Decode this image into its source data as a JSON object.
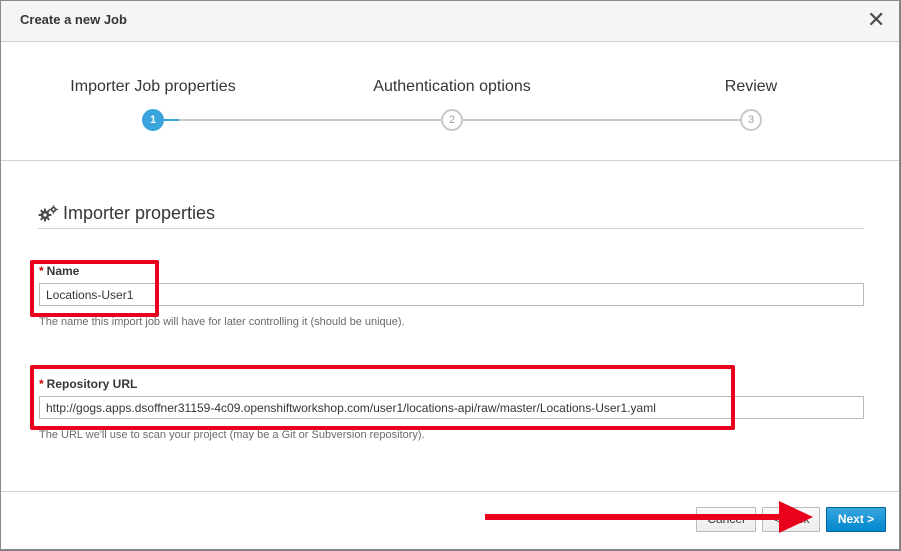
{
  "dialog": {
    "title": "Create a new Job",
    "close_symbol": "✕"
  },
  "wizard": {
    "steps": [
      {
        "label": "Importer Job properties",
        "number": "1",
        "state": "active"
      },
      {
        "label": "Authentication options",
        "number": "2",
        "state": "inactive"
      },
      {
        "label": "Review",
        "number": "3",
        "state": "inactive"
      }
    ]
  },
  "section": {
    "title": "Importer properties",
    "icon": "gears-icon"
  },
  "form": {
    "name": {
      "required_marker": "*",
      "label": "Name",
      "value": "Locations-User1",
      "help": "The name this import job will have for later controlling it (should be unique)."
    },
    "repository_url": {
      "required_marker": "*",
      "label": "Repository URL",
      "value": "http://gogs.apps.dsoffner31159-4c09.openshiftworkshop.com/user1/locations-api/raw/master/Locations-User1.yaml",
      "help": "The URL we'll use to scan your project (may be a Git or Subversion repository)."
    }
  },
  "footer": {
    "cancel_label": "Cancel",
    "back_label": "< Back",
    "next_label": "Next >"
  },
  "colors": {
    "accent": "#39a5dc",
    "primary_button": "#0088ce",
    "annotation_red": "#e8001c"
  }
}
